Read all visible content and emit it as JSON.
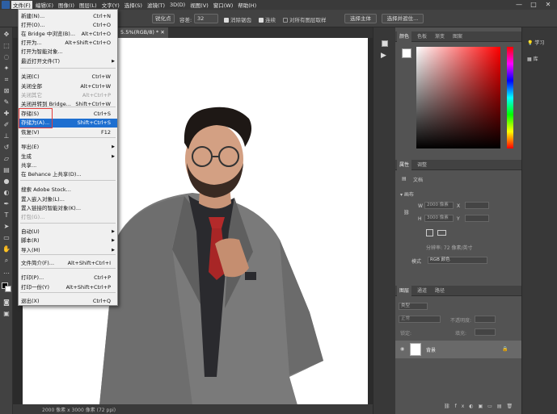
{
  "menubar": {
    "items": [
      "文件(F)",
      "编辑(E)",
      "图像(I)",
      "图层(L)",
      "文字(Y)",
      "选择(S)",
      "滤镜(T)",
      "3D(D)",
      "视图(V)",
      "窗口(W)",
      "帮助(H)"
    ],
    "window_controls": [
      "—",
      "□",
      "✕"
    ]
  },
  "options": {
    "preset": "锐化点",
    "tolerance_label": "容差:",
    "tolerance_value": "32",
    "anti_alias": "消除锯齿",
    "contiguous": "连续",
    "sample_all": "对所有图层取样",
    "select_subject": "选择主体",
    "select_and_mask": "选择并遮住..."
  },
  "document": {
    "tab_title": "5.5%(RGB/8) *",
    "status": "2000 像素 x 3000 像素 (72 ppi)"
  },
  "file_menu": {
    "items": [
      {
        "label": "新建(N)...",
        "shortcut": "Ctrl+N"
      },
      {
        "label": "打开(O)...",
        "shortcut": "Ctrl+O"
      },
      {
        "label": "在 Bridge 中浏览(B)...",
        "shortcut": "Alt+Ctrl+O"
      },
      {
        "label": "打开为...",
        "shortcut": "Alt+Shift+Ctrl+O"
      },
      {
        "label": "打开为智能对象...",
        "shortcut": ""
      },
      {
        "label": "最近打开文件(T)",
        "shortcut": ""
      },
      {
        "label": "关闭(C)",
        "shortcut": "Ctrl+W"
      },
      {
        "label": "关闭全部",
        "shortcut": "Alt+Ctrl+W"
      },
      {
        "label": "关闭其它",
        "shortcut": "Alt+Ctrl+P"
      },
      {
        "label": "关闭并转到 Bridge...",
        "shortcut": "Shift+Ctrl+W"
      },
      {
        "label": "存储(S)",
        "shortcut": "Ctrl+S"
      },
      {
        "label": "存储为(A)...",
        "shortcut": "Shift+Ctrl+S"
      },
      {
        "label": "恢复(V)",
        "shortcut": "F12"
      },
      {
        "label": "导出(E)",
        "shortcut": ""
      },
      {
        "label": "生成",
        "shortcut": ""
      },
      {
        "label": "共享...",
        "shortcut": ""
      },
      {
        "label": "在 Behance 上共享(D)...",
        "shortcut": ""
      },
      {
        "label": "搜索 Adobe Stock...",
        "shortcut": ""
      },
      {
        "label": "置入嵌入对象(L)...",
        "shortcut": ""
      },
      {
        "label": "置入链接的智能对象(K)...",
        "shortcut": ""
      },
      {
        "label": "打包(G)...",
        "shortcut": ""
      },
      {
        "label": "自动(U)",
        "shortcut": ""
      },
      {
        "label": "脚本(R)",
        "shortcut": ""
      },
      {
        "label": "导入(M)",
        "shortcut": ""
      },
      {
        "label": "文件简介(F)...",
        "shortcut": "Alt+Shift+Ctrl+I"
      },
      {
        "label": "打印(P)...",
        "shortcut": "Ctrl+P"
      },
      {
        "label": "打印一份(Y)",
        "shortcut": "Alt+Shift+Ctrl+P"
      },
      {
        "label": "退出(X)",
        "shortcut": "Ctrl+Q"
      }
    ]
  },
  "color_panel": {
    "tabs": [
      "颜色",
      "色板",
      "渐变",
      "图案"
    ]
  },
  "properties_panel": {
    "tabs": [
      "属性",
      "调整"
    ],
    "doc_label": "文档",
    "canvas_label": "画布",
    "w_label": "W",
    "w_value": "2000 像素",
    "h_label": "H",
    "h_value": "3000 像素",
    "x_label": "X",
    "y_label": "Y",
    "resolution": "分辨率: 72 像素/英寸",
    "mode_label": "模式",
    "mode_value": "RGB 颜色"
  },
  "layers_panel": {
    "tabs": [
      "图层",
      "通道",
      "路径"
    ],
    "kind": "类型",
    "blend": "正常",
    "opacity_label": "不透明度:",
    "lock_label": "锁定:",
    "fill_label": "填充:",
    "layer_name": "背景"
  },
  "right_strip": {
    "learn": "学习",
    "libraries": "库"
  },
  "colors": {
    "ui_bg": "#535353",
    "highlight": "#1e6fd0",
    "red_box": "#e23a3a"
  }
}
